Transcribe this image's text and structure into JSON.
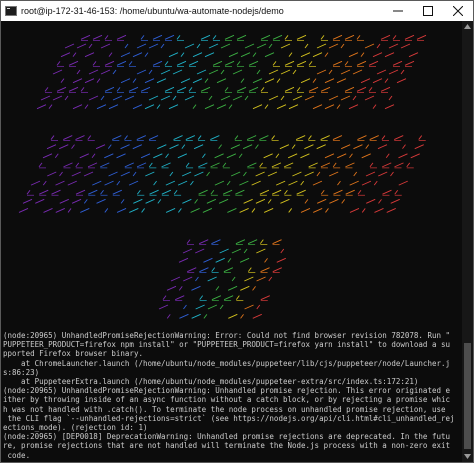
{
  "window": {
    "title": "root@ip-172-31-46-153: /home/ubuntu/wa-automate-nodejs/demo",
    "icon": "terminal-icon",
    "controls": [
      "minimize-icon",
      "maximize-icon",
      "close-icon"
    ]
  },
  "banner": {
    "description": "ASCII-art banner made of / \\ _ characters in rainbow colors",
    "colors": [
      "#7a2bb3",
      "#2f5fd6",
      "#20b2c8",
      "#3cb043",
      "#d4c21e",
      "#e0751b",
      "#d93a3a"
    ]
  },
  "log": {
    "lines": [
      "(node:20965) UnhandledPromiseRejectionWarning: Error: Could not find browser revision 782078. Run \"",
      "PUPPETEER_PRODUCT=firefox npm install\" or \"PUPPETEER_PRODUCT=firefox yarn install\" to download a su",
      "pported Firefox browser binary.",
      "    at ChromeLauncher.launch (/home/ubuntu/node_modules/puppeteer/lib/cjs/puppeteer/node/Launcher.j",
      "s:86:23)",
      "    at PuppeteerExtra.launch (/home/ubuntu/node_modules/puppeteer-extra/src/index.ts:172:21)",
      "(node:20965) UnhandledPromiseRejectionWarning: Unhandled promise rejection. This error originated e",
      "ither by throwing inside of an async function without a catch block, or by rejecting a promise whic",
      "h was not handled with .catch(). To terminate the node process on unhandled promise rejection, use",
      " the CLI flag `--unhandled-rejections=strict` (see https://nodejs.org/api/cli.html#cli_unhandled_rej",
      "ections_mode). (rejection id: 1)",
      "(node:20965) [DEP0018] DeprecationWarning: Unhandled promise rejections are deprecated. In the futu",
      "re, promise rejections that are not handled will terminate the Node.js process with a non-zero exit",
      " code."
    ]
  }
}
